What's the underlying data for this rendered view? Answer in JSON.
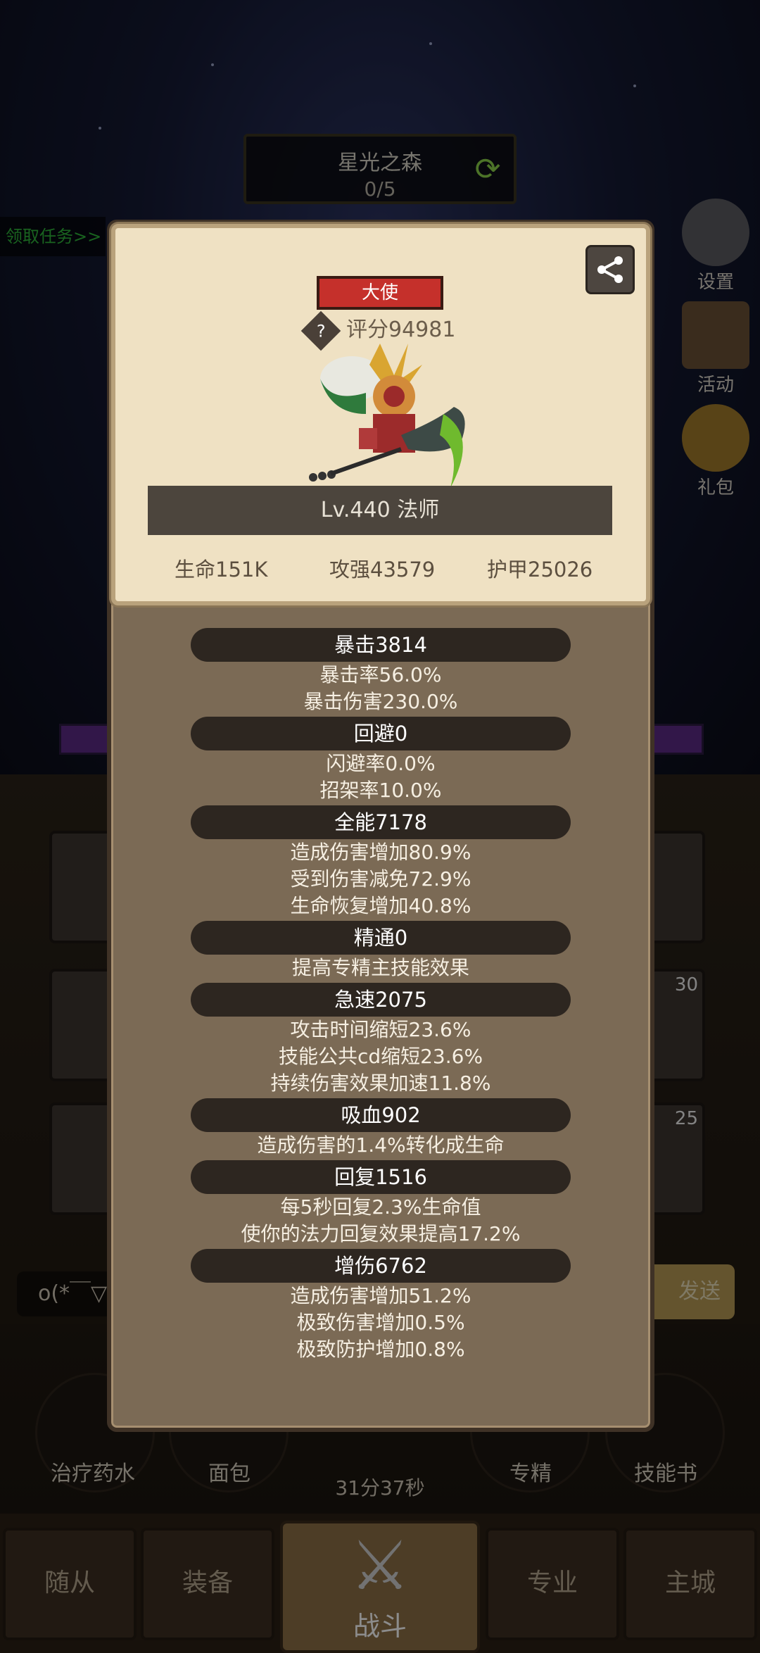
{
  "background": {
    "zone_name": "星光之森",
    "zone_progress": "0/5",
    "quest_link": "领取任务>>",
    "side_buttons": [
      {
        "label": "设置",
        "icon": "gear-icon"
      },
      {
        "label": "活动",
        "icon": "scroll-icon"
      },
      {
        "label": "礼包",
        "icon": "gift-icon"
      }
    ],
    "slot_badges": [
      "30",
      "25"
    ],
    "chat_input": "o(*￣▽",
    "chat_send": "发送",
    "items": [
      "治疗药水",
      "面包",
      "专精",
      "技能书"
    ],
    "timer": "31分37秒",
    "nav": {
      "tab1": "随从",
      "tab2": "装备",
      "tab3": "战斗",
      "tab4": "专业",
      "tab5": "主城"
    }
  },
  "card": {
    "title": "大使",
    "score": "评分94981",
    "level": "Lv.440 法师",
    "stats": {
      "hp": "生命151K",
      "atk": "攻强43579",
      "armor": "护甲25026"
    }
  },
  "attributes": [
    {
      "header": "暴击3814",
      "lines": [
        "暴击率56.0%",
        "暴击伤害230.0%"
      ]
    },
    {
      "header": "回避0",
      "lines": [
        "闪避率0.0%",
        "招架率10.0%"
      ]
    },
    {
      "header": "全能7178",
      "lines": [
        "造成伤害增加80.9%",
        "受到伤害减免72.9%",
        "生命恢复增加40.8%"
      ]
    },
    {
      "header": "精通0",
      "lines": [
        "提高专精主技能效果"
      ]
    },
    {
      "header": "急速2075",
      "lines": [
        "攻击时间缩短23.6%",
        "技能公共cd缩短23.6%",
        "持续伤害效果加速11.8%"
      ]
    },
    {
      "header": "吸血902",
      "lines": [
        "造成伤害的1.4%转化成生命"
      ]
    },
    {
      "header": "回复1516",
      "lines": [
        "每5秒回复2.3%生命值",
        "使你的法力回复效果提高17.2%"
      ]
    },
    {
      "header": "增伤6762",
      "lines": [
        "造成伤害增加51.2%",
        "极致伤害增加0.5%",
        "极致防护增加0.8%"
      ]
    }
  ]
}
